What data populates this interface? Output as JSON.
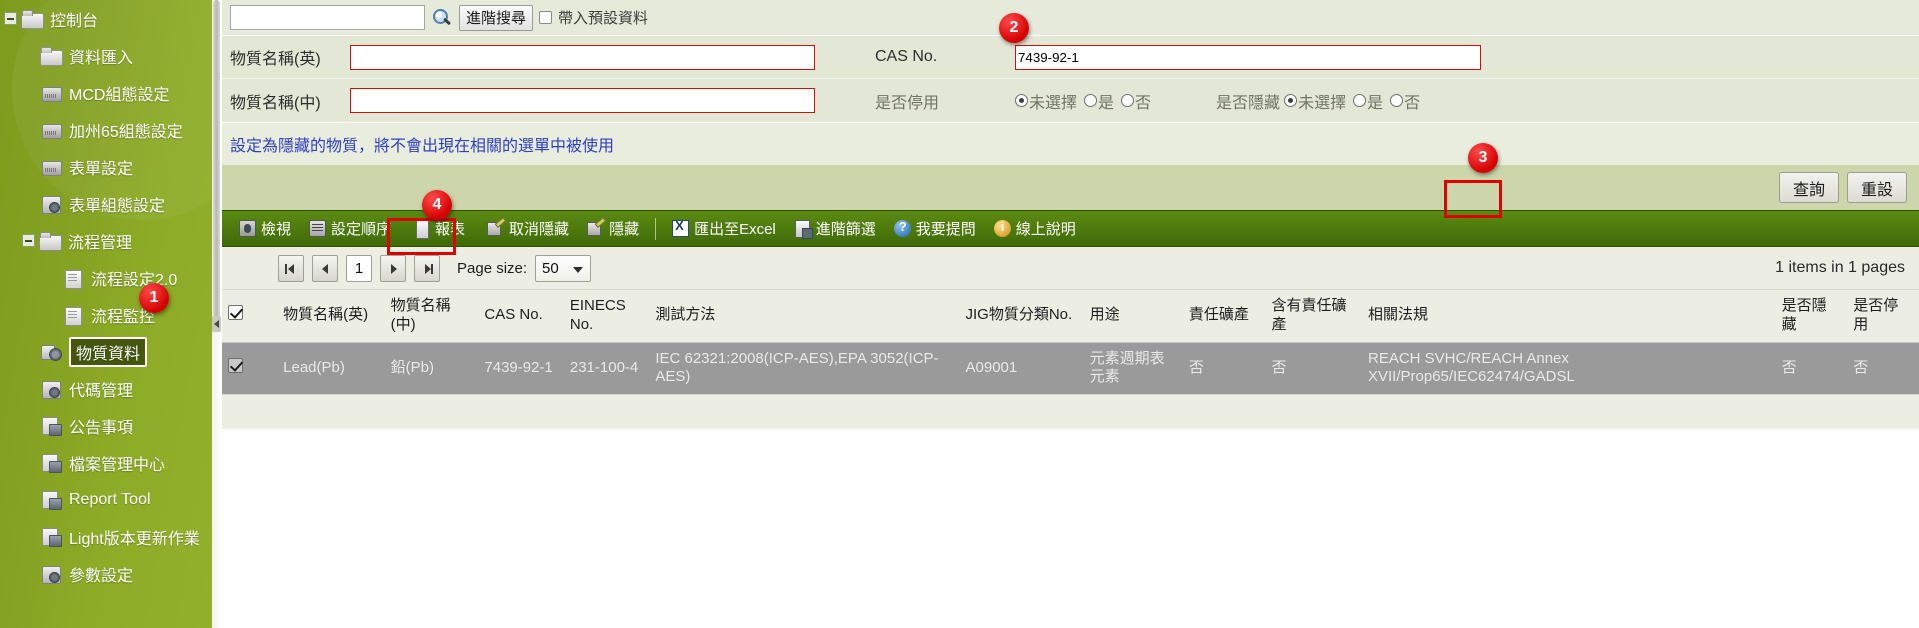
{
  "sidebar": {
    "items": [
      {
        "label": "控制台",
        "icon": "folder-icon",
        "level": 0,
        "expander": true,
        "selected": false
      },
      {
        "label": "資料匯入",
        "icon": "import-icon",
        "level": 1,
        "expander": false,
        "selected": false
      },
      {
        "label": "MCD組態設定",
        "icon": "config-icon",
        "level": 1,
        "expander": false,
        "selected": false
      },
      {
        "label": "加州65組態設定",
        "icon": "config-icon",
        "level": 1,
        "expander": false,
        "selected": false
      },
      {
        "label": "表單設定",
        "icon": "config-icon",
        "level": 1,
        "expander": false,
        "selected": false
      },
      {
        "label": "表單組態設定",
        "icon": "form-config-icon",
        "level": 1,
        "expander": false,
        "selected": false
      },
      {
        "label": "流程管理",
        "icon": "folder-icon",
        "level": 1,
        "expander": true,
        "selected": false
      },
      {
        "label": "流程設定2.0",
        "icon": "document-icon",
        "level": 2,
        "expander": false,
        "selected": false
      },
      {
        "label": "流程監控",
        "icon": "document-icon",
        "level": 2,
        "expander": false,
        "selected": false
      },
      {
        "label": "物質資料",
        "icon": "substance-icon",
        "level": 1,
        "expander": false,
        "selected": true
      },
      {
        "label": "代碼管理",
        "icon": "code-icon",
        "level": 1,
        "expander": false,
        "selected": false
      },
      {
        "label": "公告事項",
        "icon": "announcement-icon",
        "level": 1,
        "expander": false,
        "selected": false
      },
      {
        "label": "檔案管理中心",
        "icon": "file-manager-icon",
        "level": 1,
        "expander": false,
        "selected": false
      },
      {
        "label": "Report Tool",
        "icon": "report-tool-icon",
        "level": 1,
        "expander": false,
        "selected": false
      },
      {
        "label": "Light版本更新作業",
        "icon": "update-icon",
        "level": 1,
        "expander": false,
        "selected": false
      },
      {
        "label": "參數設定",
        "icon": "parameter-icon",
        "level": 1,
        "expander": false,
        "selected": false
      }
    ]
  },
  "search": {
    "quick_value": "",
    "advanced_button": "進階搜尋",
    "default_data_checkbox": "帶入預設資料",
    "default_data_checked": false,
    "magnifier_icon": "search-icon"
  },
  "form": {
    "name_en_label": "物質名稱(英)",
    "name_en_value": "",
    "cas_label": "CAS No.",
    "cas_value": "7439-92-1",
    "name_zh_label": "物質名稱(中)",
    "name_zh_value": "",
    "disabled_label": "是否停用",
    "hidden_label": "是否隱藏",
    "radio_options": [
      "未選擇",
      "是",
      "否"
    ],
    "disabled_selected": "未選擇",
    "hidden_selected": "未選擇",
    "notice": "設定為隱藏的物質，將不會出現在相關的選單中被使用",
    "query_button": "查詢",
    "reset_button": "重設"
  },
  "toolbar": {
    "items": [
      {
        "label": "檢視",
        "icon": "view-icon"
      },
      {
        "label": "設定順序",
        "icon": "sort-order-icon"
      },
      {
        "label": "報表",
        "icon": "report-icon"
      },
      {
        "label": "取消隱藏",
        "icon": "unhide-icon"
      },
      {
        "label": "隱藏",
        "icon": "hide-icon"
      },
      {
        "label": "匯出至Excel",
        "icon": "excel-export-icon"
      },
      {
        "label": "進階篩選",
        "icon": "advanced-filter-icon"
      },
      {
        "label": "我要提問",
        "icon": "question-icon"
      },
      {
        "label": "線上說明",
        "icon": "online-help-icon"
      }
    ]
  },
  "pager": {
    "page_number": "1",
    "page_size_label": "Page size:",
    "page_size_value": "50",
    "items_info": "1 items in 1 pages"
  },
  "table": {
    "headers": [
      "物質名稱(英)",
      "物質名稱(中)",
      "CAS No.",
      "EINECS No.",
      "測試方法",
      "JIG物質分類No.",
      "用途",
      "責任礦產",
      "含有責任礦產",
      "相關法規",
      "是否隱藏",
      "是否停用"
    ],
    "rows": [
      {
        "checked": true,
        "cells": [
          "Lead(Pb)",
          "鉛(Pb)",
          "7439-92-1",
          "231-100-4",
          "IEC 62321:2008(ICP-AES),EPA 3052(ICP-AES)",
          "A09001",
          "元素週期表元素",
          "否",
          "否",
          "REACH SVHC/REACH Annex XVII/Prop65/IEC62474/GADSL",
          "否",
          "否"
        ]
      }
    ],
    "header_checkbox_checked": true
  },
  "callouts": [
    {
      "number": "1"
    },
    {
      "number": "2"
    },
    {
      "number": "3"
    },
    {
      "number": "4"
    }
  ],
  "colors": {
    "sidebar_green": "#8cab26",
    "toolbar_green": "#4d7c0e",
    "accent_red": "#d40000",
    "notice_blue": "#2d3ec8",
    "form_bg": "#e3e8d6"
  }
}
